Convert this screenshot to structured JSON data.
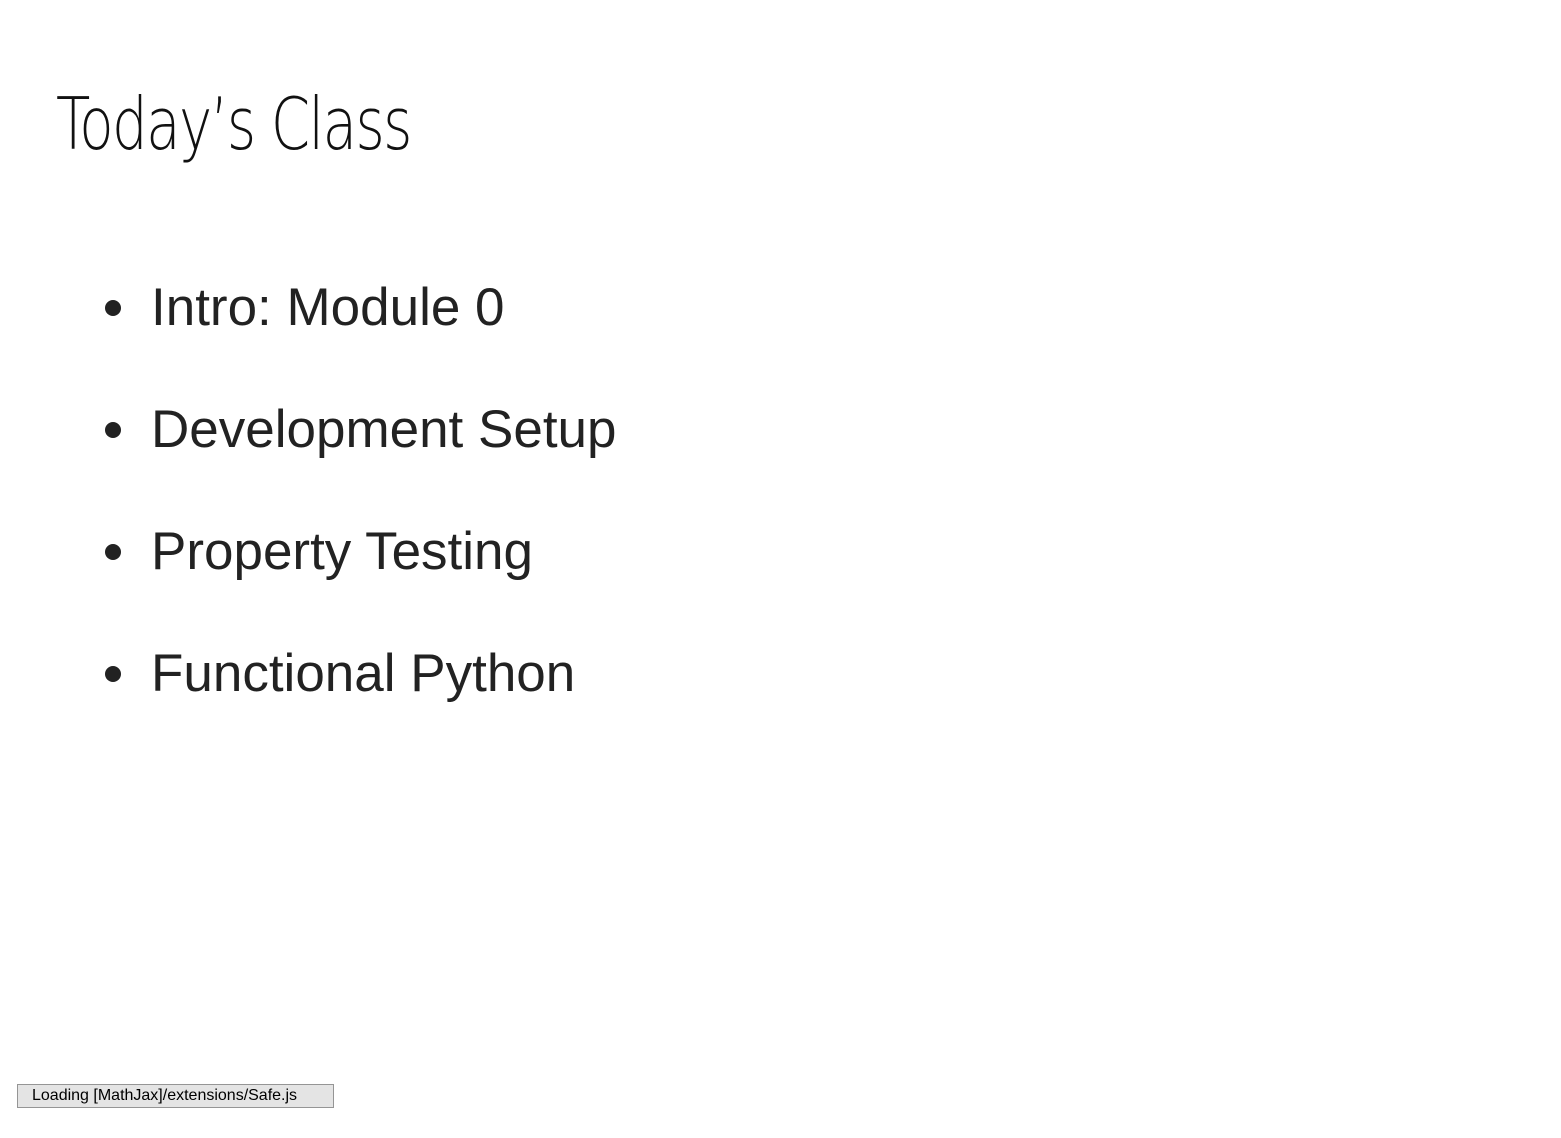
{
  "slide": {
    "title": "Today’s Class",
    "bullets": [
      "Intro: Module 0",
      "Development Setup",
      "Property Testing",
      "Functional Python"
    ]
  },
  "status": {
    "message": "Loading [MathJax]/extensions/Safe.js"
  }
}
